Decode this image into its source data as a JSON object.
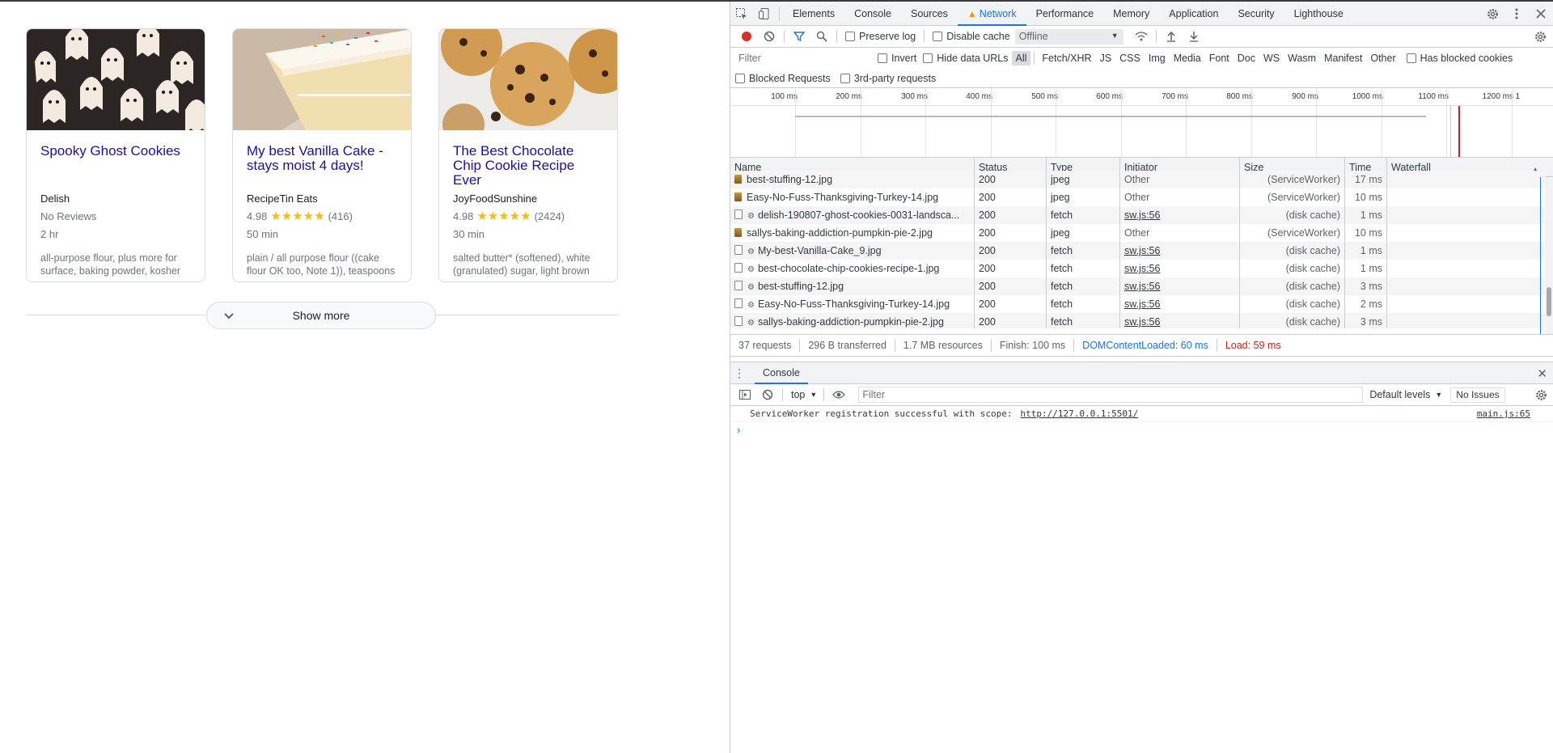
{
  "cards": [
    {
      "title": "Spooky Ghost Cookies",
      "source": "Delish",
      "rating_text": "No Reviews",
      "rating_value": "",
      "reviews": "",
      "stars": "",
      "time": "2 hr",
      "ingredients": "all-purpose flour, plus more for surface, baking powder, kosher"
    },
    {
      "title": "My best Vanilla Cake - stays moist 4 days!",
      "source": "RecipeTin Eats",
      "rating_text": "",
      "rating_value": "4.98",
      "reviews": "(416)",
      "stars": "★★★★★",
      "time": "50 min",
      "ingredients": "plain / all purpose flour ((cake flour OK too, Note 1)), teaspoons"
    },
    {
      "title": "The Best Chocolate Chip Cookie Recipe Ever",
      "source": "JoyFoodSunshine",
      "rating_text": "",
      "rating_value": "4.98",
      "reviews": "(2424)",
      "stars": "★★★★★",
      "time": "30 min",
      "ingredients": "salted butter* (softened), white (granulated) sugar, light brown"
    }
  ],
  "show_more": {
    "label": "Show more"
  },
  "devtools": {
    "tabs": [
      "Elements",
      "Console",
      "Sources",
      "Network",
      "Performance",
      "Memory",
      "Application",
      "Security",
      "Lighthouse"
    ],
    "active_tab": "Network",
    "toolbar": {
      "preserve_log": "Preserve log",
      "disable_cache": "Disable cache",
      "throttle": "Offline"
    },
    "filter": {
      "placeholder": "Filter",
      "invert": "Invert",
      "hide_data_urls": "Hide data URLs",
      "types": [
        "All",
        "Fetch/XHR",
        "JS",
        "CSS",
        "Img",
        "Media",
        "Font",
        "Doc",
        "WS",
        "Wasm",
        "Manifest",
        "Other"
      ],
      "has_blocked_cookies": "Has blocked cookies",
      "blocked_requests": "Blocked Requests",
      "third_party": "3rd-party requests"
    },
    "timeline_ticks": [
      "100 ms",
      "200 ms",
      "300 ms",
      "400 ms",
      "500 ms",
      "600 ms",
      "700 ms",
      "800 ms",
      "900 ms",
      "1000 ms",
      "1100 ms",
      "1200 ms",
      "1"
    ],
    "columns": [
      "Name",
      "Status",
      "Type",
      "Initiator",
      "Size",
      "Time",
      "Waterfall"
    ],
    "rows": [
      {
        "icon": "img",
        "name": "best-stuffing-12.jpg",
        "status": "200",
        "type": "jpeg",
        "initiator": "Other",
        "size": "(ServiceWorker)",
        "time": "17 ms"
      },
      {
        "icon": "img",
        "name": "Easy-No-Fuss-Thanksgiving-Turkey-14.jpg",
        "status": "200",
        "type": "jpeg",
        "initiator": "Other",
        "size": "(ServiceWorker)",
        "time": "10 ms"
      },
      {
        "icon": "doc",
        "name": "delish-190807-ghost-cookies-0031-landsca...",
        "status": "200",
        "type": "fetch",
        "initiator": "sw.js:56",
        "size": "(disk cache)",
        "time": "1 ms"
      },
      {
        "icon": "img",
        "name": "sallys-baking-addiction-pumpkin-pie-2.jpg",
        "status": "200",
        "type": "jpeg",
        "initiator": "Other",
        "size": "(ServiceWorker)",
        "time": "10 ms"
      },
      {
        "icon": "doc",
        "name": "My-best-Vanilla-Cake_9.jpg",
        "status": "200",
        "type": "fetch",
        "initiator": "sw.js:56",
        "size": "(disk cache)",
        "time": "1 ms"
      },
      {
        "icon": "doc",
        "name": "best-chocolate-chip-cookies-recipe-1.jpg",
        "status": "200",
        "type": "fetch",
        "initiator": "sw.js:56",
        "size": "(disk cache)",
        "time": "1 ms"
      },
      {
        "icon": "doc",
        "name": "best-stuffing-12.jpg",
        "status": "200",
        "type": "fetch",
        "initiator": "sw.js:56",
        "size": "(disk cache)",
        "time": "3 ms"
      },
      {
        "icon": "doc",
        "name": "Easy-No-Fuss-Thanksgiving-Turkey-14.jpg",
        "status": "200",
        "type": "fetch",
        "initiator": "sw.js:56",
        "size": "(disk cache)",
        "time": "2 ms"
      },
      {
        "icon": "doc",
        "name": "sallys-baking-addiction-pumpkin-pie-2.jpg",
        "status": "200",
        "type": "fetch",
        "initiator": "sw.js:56",
        "size": "(disk cache)",
        "time": "3 ms"
      }
    ],
    "summary": {
      "requests": "37 requests",
      "transferred": "296 B transferred",
      "resources": "1.7 MB resources",
      "finish": "Finish: 100 ms",
      "dcl": "DOMContentLoaded: 60 ms",
      "load": "Load: 59 ms"
    },
    "drawer": {
      "tab": "Console",
      "context": "top",
      "filter_placeholder": "Filter",
      "levels": "Default levels",
      "issues": "No Issues",
      "message": "ServiceWorker registration successful with scope:",
      "message_url": "http://127.0.0.1:5501/",
      "message_source": "main.js:65"
    }
  },
  "colors": {
    "link": "#1a0dab",
    "star": "#fbbc04",
    "accent": "#1a73e8",
    "load": "#c5221f"
  }
}
